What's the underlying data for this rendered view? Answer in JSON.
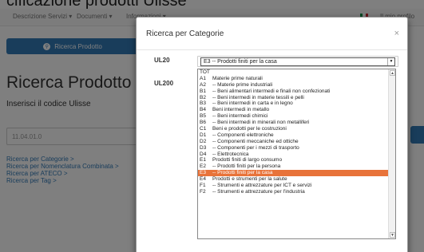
{
  "background": {
    "title_partial": "cificazione prodotti Ulisse",
    "nav": [
      "Descrizione Servizi ▾",
      "Documenti ▾",
      "Informazioni ▾",
      "Il mio profilo"
    ],
    "search_pill_label": "Ricerca Prodotto",
    "heading": "Ricerca Prodotto",
    "subheading": "Inserisci il codice Ulisse",
    "code_value": "11.04.01.0",
    "side_links": [
      "Ricerca per Categorie >",
      "Ricerca per Nomenclatura Combinata >",
      "Ricerca per ATECO >",
      "Ricerca per Tag >"
    ]
  },
  "modal": {
    "title": "Ricerca per Categorie",
    "close": "×",
    "label_ul20": "UL20",
    "label_ul200": "UL200",
    "selected_value": "E3 -- Prodotti finiti per la casa",
    "options": [
      [
        "TOT",
        ""
      ],
      [
        "A1",
        "Materie prime naturali"
      ],
      [
        "A2",
        "-- Materie prime industriali"
      ],
      [
        "B1",
        "-- Beni alimentari intermedi e finali non confezionati"
      ],
      [
        "B2",
        "-- Beni intermedi in materie tessili e pelli"
      ],
      [
        "B3",
        "-- Beni intermedi in carta e in legno"
      ],
      [
        "B4",
        "Beni intermedi in metallo"
      ],
      [
        "B5",
        "-- Beni intermedi chimici"
      ],
      [
        "B6",
        "-- Beni intermedi in minerali non metalliferi"
      ],
      [
        "C1",
        "Beni e prodotti per le costruzioni"
      ],
      [
        "D1",
        "-- Componenti elettroniche"
      ],
      [
        "D2",
        "-- Componenti meccaniche ed ottiche"
      ],
      [
        "D3",
        "-- Componenti per i mezzi di trasporto"
      ],
      [
        "D4",
        "-- Elettrotecnica"
      ],
      [
        "E1",
        "Prodotti finiti di largo consumo"
      ],
      [
        "E2",
        "-- Prodotti finiti per la persona"
      ],
      [
        "E3",
        "-- Prodotti finiti per la casa"
      ],
      [
        "E4",
        "Prodotti e strumenti per la salute"
      ],
      [
        "F1",
        "-- Strumenti e attrezzature per ICT e servizi"
      ],
      [
        "F2",
        "-- Strumenti e attrezzature per l'industria"
      ]
    ],
    "selected_index": 16
  }
}
